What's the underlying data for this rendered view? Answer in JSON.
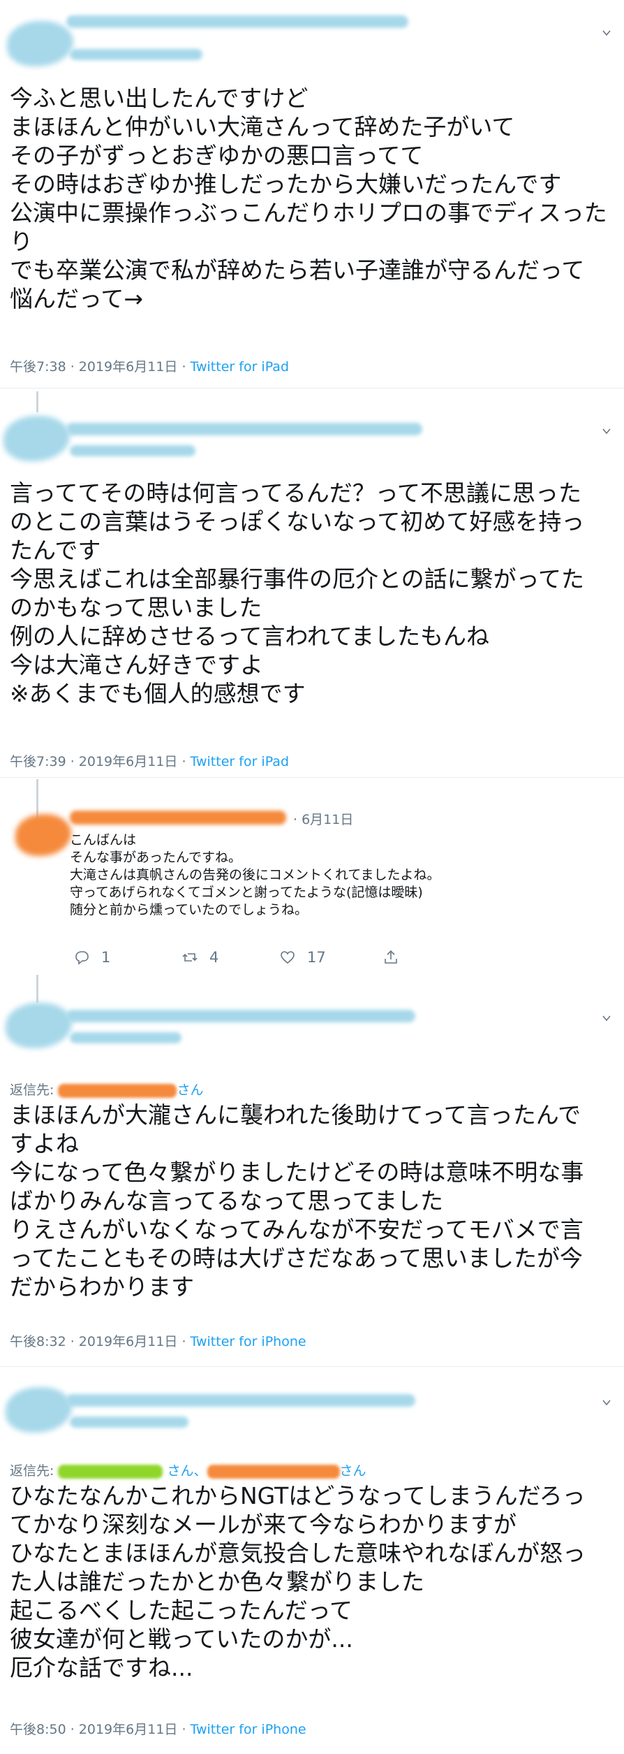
{
  "tweets": [
    {
      "lines": [
        "今ふと思い出したんですけど",
        "まほほんと仲がいい大滝さんって辞めた子がいて",
        "その子がずっとおぎゆかの悪口言ってて",
        "その時はおぎゆか推しだったから大嫌いだったんです",
        "公演中に票操作っぶっこんだりホリプロの事でディスった",
        "り",
        "でも卒業公演で私が辞めたら若い子達誰が守るんだって",
        "悩んだって→"
      ],
      "meta": "午後7:38 · 2019年6月11日 · ",
      "source": "Twitter for iPad"
    },
    {
      "lines": [
        "言っててその時は何言ってるんだ？って不思議に思った",
        "のとこの言葉はうそっぽくないなって初めて好感を持っ",
        "たんです",
        "今思えばこれは全部暴行事件の厄介との話に繋がってた",
        "のかもなって思いました",
        "例の人に辞めさせるって言われてましたもんね",
        "今は大滝さん好きですよ",
        "※あくまでも個人的感想です"
      ],
      "meta": "午後7:39 · 2019年6月11日 · ",
      "source": "Twitter for iPad"
    },
    {
      "reply_to_label": "返信先: ",
      "reply_to_suffix": "さん",
      "lines": [
        "まほほんが大瀧さんに襲われた後助けてって言ったんで",
        "すよね",
        "今になって色々繋がりましたけどその時は意味不明な事",
        "ばかりみんな言ってるなって思ってました",
        "りえさんがいなくなってみんなが不安だってモバメで言",
        "ってたこともその時は大げさだなあって思いましたが今",
        "だからわかります"
      ],
      "meta": "午後8:32 · 2019年6月11日 · ",
      "source": "Twitter for iPhone"
    },
    {
      "reply_to_label": "返信先: ",
      "reply_to_mid": " さん、",
      "reply_to_suffix": "さん",
      "lines": [
        "ひなたなんかこれからNGTはどうなってしまうんだろっ",
        "てかなり深刻なメールが来て今ならわかりますが",
        "ひなたとまほほんが意気投合した意味やれなぼんが怒っ",
        "た人は誰だったかとか色々繋がりました",
        "起こるべくした起こったんだって",
        "彼女達が何と戦っていたのかが...",
        "厄介な話ですね..."
      ],
      "meta": "午後8:50 · 2019年6月11日 · ",
      "source": "Twitter for iPhone"
    }
  ],
  "reply": {
    "date": "· 6月11日",
    "lines": [
      "こんばんは",
      "そんな事があったんですね。",
      "大滝さんは真帆さんの告発の後にコメントくれてましたよね。",
      "守ってあげられなくてゴメンと謝ってたような(記憶は曖昧)",
      "随分と前から燻っていたのでしょうね。"
    ],
    "reply_count": "1",
    "retweet_count": "4",
    "like_count": "17"
  },
  "colors": {
    "redaction_blue": "#a6d8ea",
    "redaction_orange": "#f58a3c",
    "redaction_green": "#8fd62a",
    "link_blue": "#1da1f2",
    "meta_gray": "#657786"
  },
  "icons": [
    "chevron-down-icon",
    "reply-icon",
    "retweet-icon",
    "like-icon",
    "share-icon"
  ]
}
